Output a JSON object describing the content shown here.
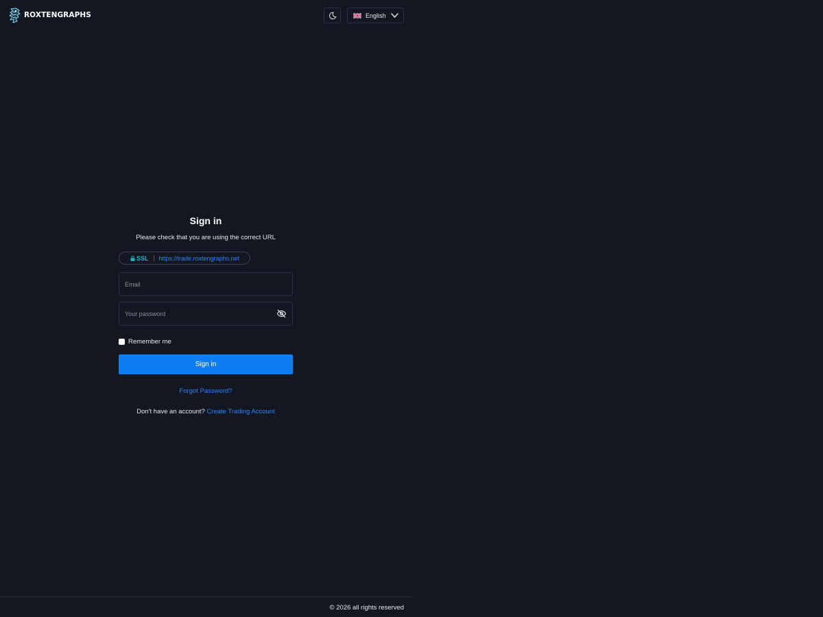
{
  "header": {
    "brand": "ROXTENGRAPHS",
    "language": {
      "selected": "English"
    }
  },
  "form": {
    "title": "Sign in",
    "subtitle": "Please check that you are using the correct URL",
    "ssl_label": "SSL",
    "url": "https://trade.roxtengraphs.net",
    "email": {
      "value": "",
      "placeholder": "Email"
    },
    "password": {
      "value": "",
      "placeholder": "Your password"
    },
    "remember_label": "Remember me",
    "submit_label": "Sign in",
    "forgot_label": "Forgot Password?",
    "signup_prompt": "Don't have an account?",
    "signup_link": "Create Trading Account"
  },
  "footer": {
    "copyright": "© 2026 all rights reserved"
  },
  "colors": {
    "background": "#131722",
    "primary": "#0d7df2",
    "link": "#2f83f7",
    "ssl": "#21b6c8",
    "border": "#2d3342"
  },
  "icons": {
    "theme": "moon-icon",
    "language": "uk-flag-icon",
    "dropdown": "chevron-down-icon",
    "password_toggle": "eye-off-icon",
    "ssl": "lock-icon"
  }
}
